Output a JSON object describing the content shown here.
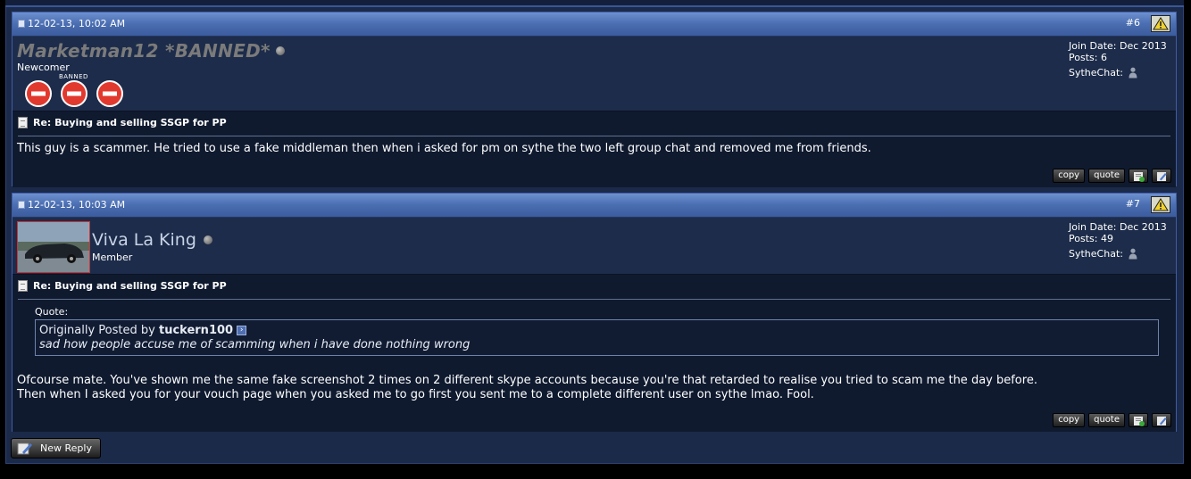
{
  "posts": [
    {
      "date": "12-02-13, 10:02 AM",
      "number": "#6",
      "username": "Marketman12 *BANNED*",
      "user_title": "Newcomer",
      "badge_label": "BANNED",
      "join_date": "Join Date: Dec 2013",
      "posts_count": "Posts: 6",
      "sythechat_label": "SytheChat:",
      "title": "Re: Buying and selling SSGP for PP",
      "body_lines": [
        "This guy is a scammer. He tried to use a fake middleman then when i asked for pm on sythe the two left group chat and removed me from friends."
      ],
      "actions": {
        "copy": "copy",
        "quote": "quote"
      }
    },
    {
      "date": "12-02-13, 10:03 AM",
      "number": "#7",
      "username": "Viva La King",
      "user_title": "Member",
      "join_date": "Join Date: Dec 2013",
      "posts_count": "Posts: 49",
      "sythechat_label": "SytheChat:",
      "title": "Re: Buying and selling SSGP for PP",
      "quote_label": "Quote:",
      "quote_prefix": "Originally Posted by",
      "quote_author": "tuckern100",
      "quote_text": "sad how people accuse me of scamming when i have done nothing wrong",
      "body_lines": [
        "Ofcourse mate. You've shown me the same fake screenshot 2 times on 2 different skype accounts because you're that retarded to realise you tried to scam me the day before.",
        "Then when I asked you for your vouch page when you asked me to go first you sent me to a complete different user on sythe lmao. Fool."
      ],
      "actions": {
        "copy": "copy",
        "quote": "quote"
      }
    }
  ],
  "new_reply_label": "New Reply"
}
